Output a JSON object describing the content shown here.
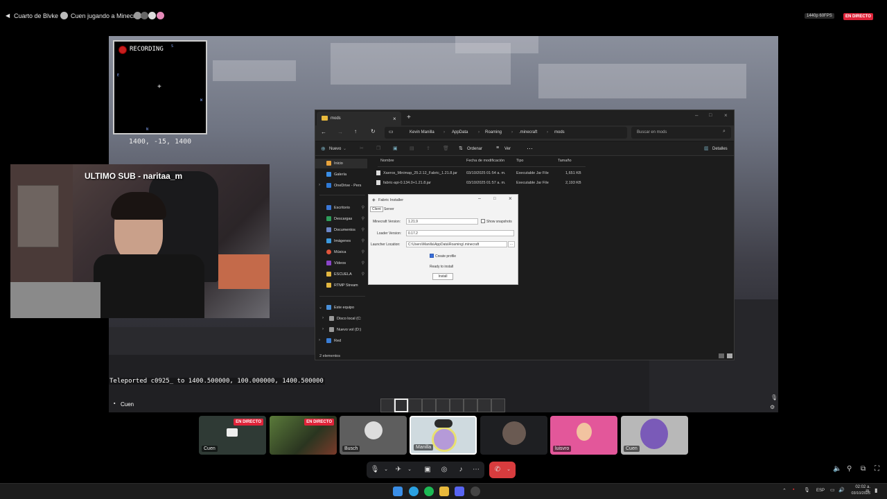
{
  "discord": {
    "server_name": "Cuarto de Blvke",
    "activity": "Cuen jugando a Minecraft",
    "quality": "1440p 60FPS",
    "live_badge": "EN DIRECTO"
  },
  "minimap": {
    "recording": "RECORDING",
    "cardinal_n": "S",
    "cardinal_w": "E",
    "cardinal_e": "W",
    "cardinal_s": "N",
    "coords": "1400, -15, 1400"
  },
  "overlay": {
    "last_sub": "ULTIMO SUB - naritaa_m"
  },
  "explorer": {
    "tab_title": "mods",
    "breadcrumb": [
      "Kevin Manilla",
      "AppData",
      "Roaming",
      ".minecraft",
      "mods"
    ],
    "search_placeholder": "Buscar en mods",
    "cmd": {
      "new": "Nuevo",
      "sort": "Ordenar",
      "view": "Ver",
      "details": "Detalles"
    },
    "columns": [
      "Nombre",
      "Fecha de modificación",
      "Tipo",
      "Tamaño"
    ],
    "files": [
      {
        "name": "Xaeros_Minimap_25.2.12_Fabric_1.21.8.jar",
        "date": "03/10/2025 01:54 a. m.",
        "type": "Executable Jar File",
        "size": "1,651 KB"
      },
      {
        "name": "fabric-api-0.134.0+1.21.8.jar",
        "date": "03/10/2025 01:57 a. m.",
        "type": "Executable Jar File",
        "size": "2,193 KB"
      }
    ],
    "nav": [
      {
        "label": "Inicio",
        "color": "#e8a33c"
      },
      {
        "label": "Galería",
        "color": "#3a8ee6"
      },
      {
        "label": "OneDrive - Pers",
        "color": "#2f7ad6"
      },
      {
        "label": "Escritorio",
        "color": "#3b78d8"
      },
      {
        "label": "Descargas",
        "color": "#2e9e5b"
      },
      {
        "label": "Documentos",
        "color": "#6b86c7"
      },
      {
        "label": "Imágenes",
        "color": "#3c9adf"
      },
      {
        "label": "Música",
        "color": "#e0553b"
      },
      {
        "label": "Vídeos",
        "color": "#8b45c9"
      },
      {
        "label": "ESCUELA",
        "color": "#e2b640"
      },
      {
        "label": "RTMP Stream",
        "color": "#e2b640"
      },
      {
        "label": "Este equipo",
        "color": "#4a90d9"
      },
      {
        "label": "Disco local (C:",
        "color": "#9a9a9a"
      },
      {
        "label": "Nuevo vol (D:)",
        "color": "#9a9a9a"
      },
      {
        "label": "Red",
        "color": "#3a7ed6"
      }
    ],
    "status": "2 elementos"
  },
  "fabric": {
    "title": "Fabric Installer",
    "tab_client": "Client",
    "tab_server": "Server",
    "mc_label": "Minecraft Version:",
    "mc_value": "1.21.9",
    "snapshots": "Show snapshots",
    "loader_label": "Loader Version:",
    "loader_value": "0.17.2",
    "location_label": "Launcher Location:",
    "location_value": "C:\\Users\\Manilla\\AppData\\Roaming\\.minecraft",
    "browse": "...",
    "create_profile": "Create profile",
    "status": "Ready to install",
    "install": "Install"
  },
  "chat": {
    "teleport": "Teleported c0925_ to 1400.500000, 100.000000, 1400.500000",
    "speaker": "Cuen"
  },
  "tiles": [
    {
      "name": "Cuen",
      "live": true,
      "bg": "#2f3a35"
    },
    {
      "name": "",
      "live": true,
      "bg": "#3b4a2f"
    },
    {
      "name": "Busch",
      "live": false,
      "bg": "#5e5e5e"
    },
    {
      "name": "Manilla",
      "live": false,
      "bg": "#cfdadf"
    },
    {
      "name": "",
      "live": false,
      "bg": "#1e1f22"
    },
    {
      "name": "luisvro",
      "live": false,
      "bg": "#e3579a"
    },
    {
      "name": "Cuen",
      "live": false,
      "bg": "#b8b8b8"
    }
  ],
  "taskbar": {
    "lang": "ESP",
    "time": "02:02 a. m.",
    "date": "03/10/2025"
  }
}
